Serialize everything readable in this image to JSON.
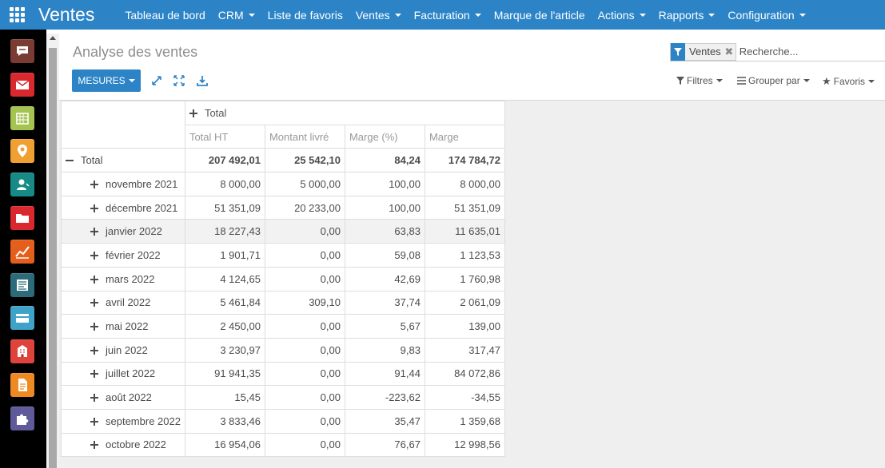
{
  "app": {
    "title": "Ventes",
    "menu": [
      {
        "label": "Tableau de bord",
        "dropdown": false
      },
      {
        "label": "CRM",
        "dropdown": true
      },
      {
        "label": "Liste de favoris",
        "dropdown": false
      },
      {
        "label": "Ventes",
        "dropdown": true
      },
      {
        "label": "Facturation",
        "dropdown": true
      },
      {
        "label": "Marque de l'article",
        "dropdown": false
      },
      {
        "label": "Actions",
        "dropdown": true
      },
      {
        "label": "Rapports",
        "dropdown": true
      },
      {
        "label": "Configuration",
        "dropdown": true
      }
    ]
  },
  "sidebar_apps": [
    {
      "name": "discuss-icon",
      "color": "#7a3b33"
    },
    {
      "name": "mail-icon",
      "color": "#d9282e"
    },
    {
      "name": "calendar-icon",
      "color": "#a5c351"
    },
    {
      "name": "map-pin-icon",
      "color": "#f0a033"
    },
    {
      "name": "contacts-icon",
      "color": "#178a87"
    },
    {
      "name": "folder-icon",
      "color": "#d9282e"
    },
    {
      "name": "chart-icon",
      "color": "#e55f1c"
    },
    {
      "name": "newspaper-icon",
      "color": "#2c6b7a"
    },
    {
      "name": "card-icon",
      "color": "#3ea3c6"
    },
    {
      "name": "building-icon",
      "color": "#e0433b"
    },
    {
      "name": "document-icon",
      "color": "#ef8a22"
    },
    {
      "name": "puzzle-icon",
      "color": "#5f5b9b"
    }
  ],
  "control_panel": {
    "title": "Analyse des ventes",
    "measures_label": "MESURES",
    "search": {
      "facet_label": "Ventes",
      "placeholder": "Recherche..."
    },
    "filters_label": "Filtres",
    "group_by_label": "Grouper par",
    "favorites_label": "Favoris"
  },
  "pivot": {
    "column_group_label": "Total",
    "measures": [
      "Total HT",
      "Montant livré",
      "Marge (%)",
      "Marge"
    ],
    "total_row": {
      "label": "Total",
      "values": [
        "207 492,01",
        "25 542,10",
        "84,24",
        "174 784,72"
      ]
    },
    "rows": [
      {
        "label": "novembre 2021",
        "values": [
          "8 000,00",
          "5 000,00",
          "100,00",
          "8 000,00"
        ]
      },
      {
        "label": "décembre 2021",
        "values": [
          "51 351,09",
          "20 233,00",
          "100,00",
          "51 351,09"
        ]
      },
      {
        "label": "janvier 2022",
        "values": [
          "18 227,43",
          "0,00",
          "63,83",
          "11 635,01"
        ]
      },
      {
        "label": "février 2022",
        "values": [
          "1 901,71",
          "0,00",
          "59,08",
          "1 123,53"
        ]
      },
      {
        "label": "mars 2022",
        "values": [
          "4 124,65",
          "0,00",
          "42,69",
          "1 760,98"
        ]
      },
      {
        "label": "avril 2022",
        "values": [
          "5 461,84",
          "309,10",
          "37,74",
          "2 061,09"
        ]
      },
      {
        "label": "mai 2022",
        "values": [
          "2 450,00",
          "0,00",
          "5,67",
          "139,00"
        ]
      },
      {
        "label": "juin 2022",
        "values": [
          "3 230,97",
          "0,00",
          "9,83",
          "317,47"
        ]
      },
      {
        "label": "juillet 2022",
        "values": [
          "91 941,35",
          "0,00",
          "91,44",
          "84 072,86"
        ]
      },
      {
        "label": "août 2022",
        "values": [
          "15,45",
          "0,00",
          "-223,62",
          "-34,55"
        ]
      },
      {
        "label": "septembre 2022",
        "values": [
          "3 833,46",
          "0,00",
          "35,47",
          "1 359,68"
        ]
      },
      {
        "label": "octobre 2022",
        "values": [
          "16 954,06",
          "0,00",
          "76,67",
          "12 998,56"
        ]
      }
    ]
  }
}
